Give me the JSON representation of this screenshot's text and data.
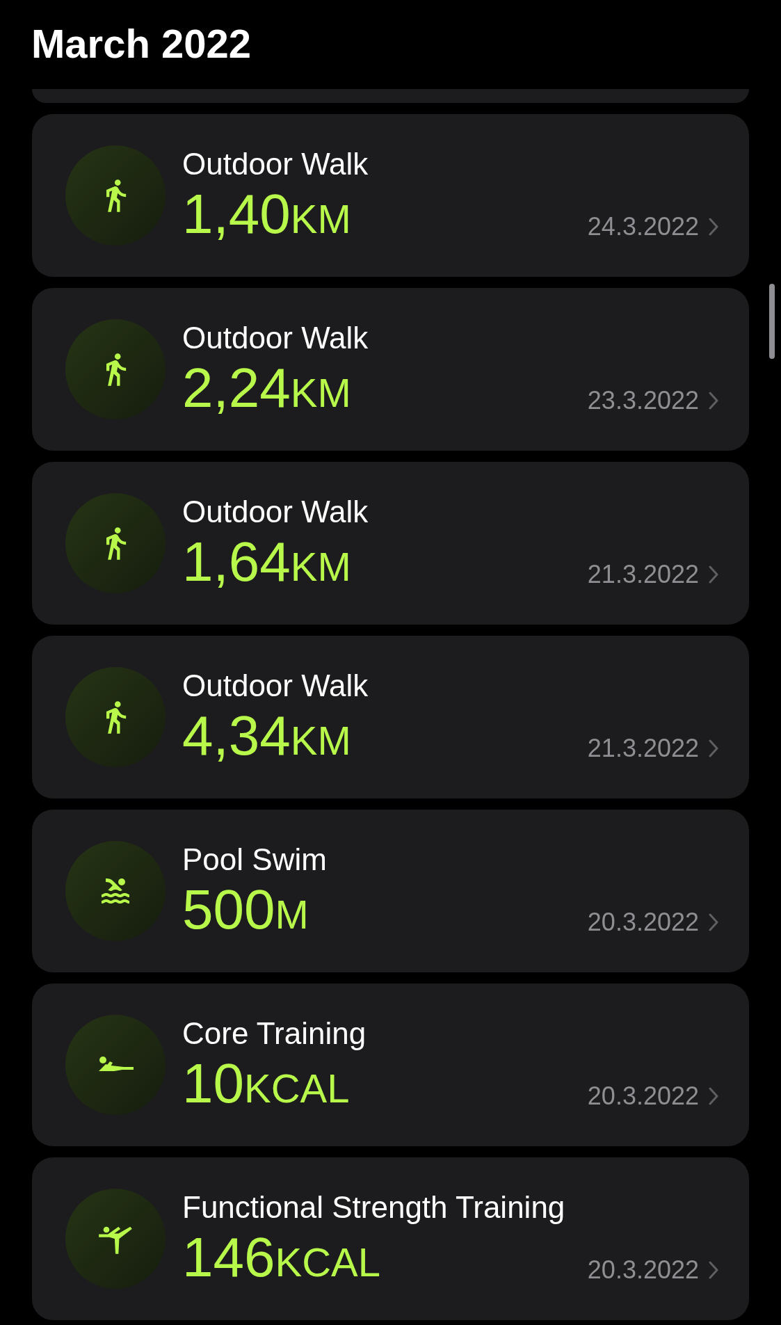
{
  "header": {
    "title": "March 2022"
  },
  "workouts": [
    {
      "kind": "walk",
      "name": "Outdoor Walk",
      "value": "1,40",
      "unit": "KM",
      "date": "24.3.2022"
    },
    {
      "kind": "walk",
      "name": "Outdoor Walk",
      "value": "2,24",
      "unit": "KM",
      "date": "23.3.2022"
    },
    {
      "kind": "walk",
      "name": "Outdoor Walk",
      "value": "1,64",
      "unit": "KM",
      "date": "21.3.2022"
    },
    {
      "kind": "walk",
      "name": "Outdoor Walk",
      "value": "4,34",
      "unit": "KM",
      "date": "21.3.2022"
    },
    {
      "kind": "swim",
      "name": "Pool Swim",
      "value": "500",
      "unit": "M",
      "date": "20.3.2022"
    },
    {
      "kind": "core",
      "name": "Core Training",
      "value": "10",
      "unit": "KCAL",
      "date": "20.3.2022"
    },
    {
      "kind": "strength",
      "name": "Functional Strength Training",
      "value": "146",
      "unit": "KCAL",
      "date": "20.3.2022"
    }
  ]
}
